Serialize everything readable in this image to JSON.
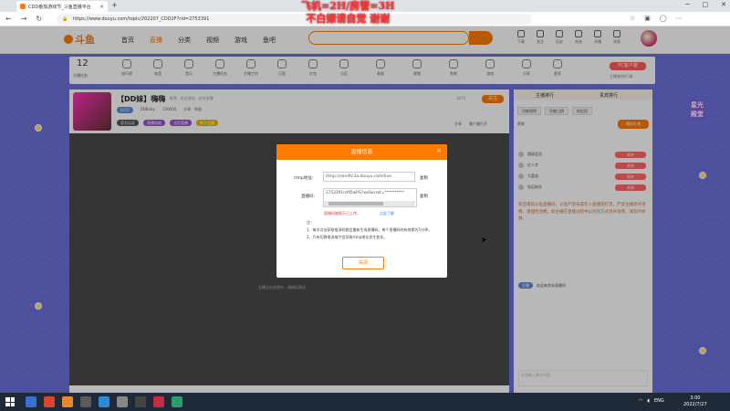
{
  "browser": {
    "tab_title": "CDD番茄游戏节_斗鱼直播平台",
    "url": "https://www.douyu.com/topic/202207_CDD2F?rid=2753391"
  },
  "overlay_text": [
    "飞机=2H/房管=3H",
    "不白嫖请自觉 谢谢"
  ],
  "site": {
    "logo_text": "斗鱼",
    "nav": [
      "首页",
      "直播",
      "分类",
      "视频",
      "游戏",
      "鱼吧"
    ],
    "header_icons": [
      "下载",
      "关注",
      "历史",
      "任务",
      "开播",
      "消息"
    ]
  },
  "category_bar": {
    "count": "12",
    "count_label": "主播任务",
    "items": [
      "排行榜",
      "电竞",
      "音乐",
      "主播任务",
      "主播工作",
      "日签",
      "红包",
      "分区",
      "贵族",
      "视频",
      "鱼吧",
      "游戏",
      "分享",
      "更多"
    ],
    "pc_button": "PC客户端",
    "pc_sub": "主播来到PC端"
  },
  "room": {
    "title": "【DD妹】嗨嗨",
    "meta": "推荐 · 射击游戏 · 综合直播",
    "level": "LV10",
    "owner": "DDBaby",
    "hot": "130000",
    "report": "分享 · 举报",
    "tags": [
      "官方认证",
      "直播热度",
      "全民直播",
      "新人主播"
    ],
    "follow_count": "3870",
    "follow_label": "关注",
    "actions": [
      "分享",
      "客户端打开"
    ]
  },
  "player": {
    "offline_text": "主播正在休息中，请稍后再试"
  },
  "sidebar": {
    "header_left": "主播排行",
    "header_right": "贵宾排行",
    "tabs": [
      "贡献周榜",
      "贡献日榜",
      "粉丝团"
    ],
    "subtitle": "贵宾",
    "rank_button": "赠送礼物",
    "rank_names": [
      "超级会员",
      "红十字",
      "大富翁",
      "钻石粉丝"
    ],
    "rank_badge": "贵宾",
    "notice": "欢迎来到斗鱼直播间，斗鱼严禁未成年人直播或打赏，严禁主播诱导消费，请理性消费。如主播在直播过程中以任何方式诱导消费，请及时举报。",
    "chat_user": "主播",
    "chat_text": "欢迎来到本直播间",
    "input_placeholder": "这里输入聊天内容"
  },
  "promo": [
    "星光",
    "殿堂"
  ],
  "modal": {
    "title": "直播信息",
    "rtmp_label": "rtmp地址:",
    "rtmp_value": "rtmp://sendtc3a.douyu.com/live",
    "copy": "复制",
    "code_label": "直播码:",
    "code_value": "2753391rcM5wPG?wsSecret=**********",
    "warning": "直播码被提示已上传。",
    "learn_more": "点此了解",
    "notes_title": "注：",
    "notes": [
      "1、每次点击获取推流码都会重新生成直播码，每个直播码的有效期为5分钟。",
      "2、只有切换推流域才会导致rtmp地址发生变化。"
    ],
    "close_button": "关闭"
  },
  "taskbar": {
    "lang": "ENG",
    "time": "3:00",
    "date": "2022/7/27"
  }
}
